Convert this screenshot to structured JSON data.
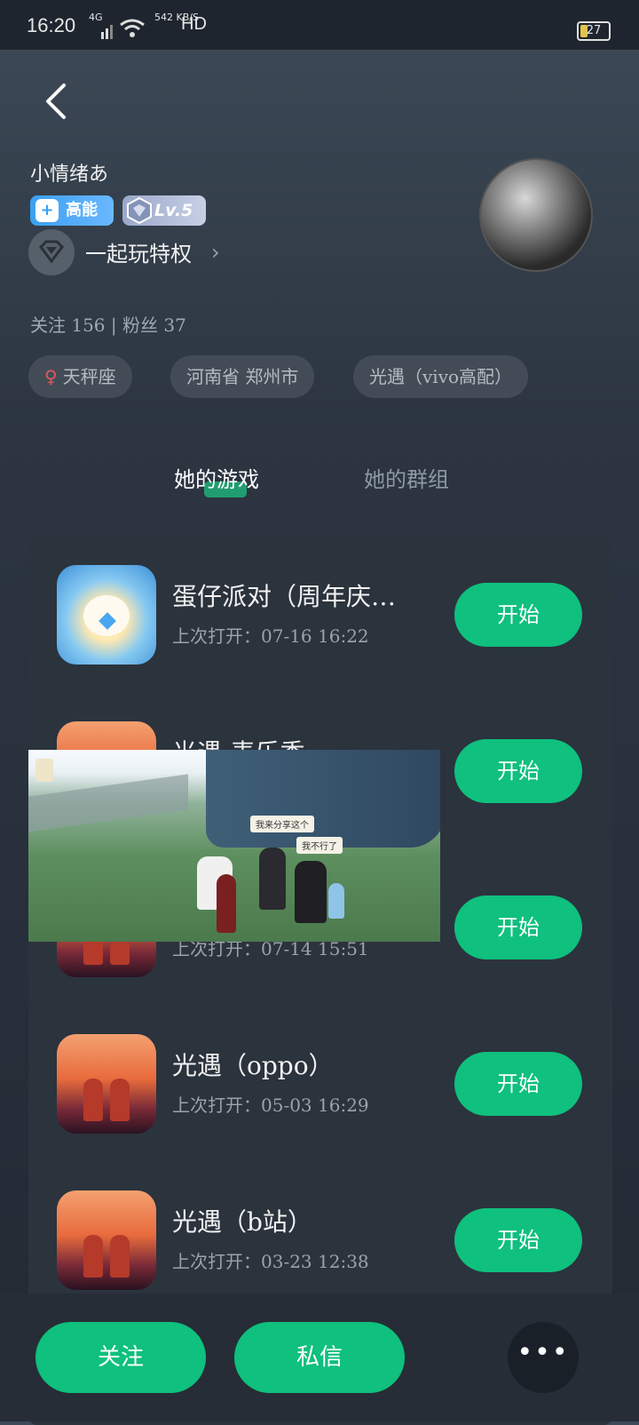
{
  "status_bar": {
    "time": "16:20",
    "network": "4G",
    "speed": "542 KB/S",
    "hd": "HD",
    "battery": "27"
  },
  "profile": {
    "name": "小情绪あ",
    "badge_high": "高能",
    "badge_level": "Lv.5",
    "privilege": "一起玩特权",
    "stats": "关注 156 | 粉丝 37",
    "tags": [
      "天秤座",
      "河南省 郑州市",
      "光遇（vivo高配）"
    ]
  },
  "tabs": {
    "games": "她的游戏",
    "groups": "她的群组"
  },
  "games": [
    {
      "title": "蛋仔派对（周年庆…",
      "last_open": "上次打开：07-16 16:22",
      "button": "开始"
    },
    {
      "title": "光遇-麦乐季",
      "last_open": "",
      "button": "开始"
    },
    {
      "title": "",
      "last_open": "上次打开：07-14 15:51",
      "button": "开始"
    },
    {
      "title": "光遇（oppo）",
      "last_open": "上次打开：05-03 16:29",
      "button": "开始"
    },
    {
      "title": "光遇（b站）",
      "last_open": "上次打开：03-23 12:38",
      "button": "开始"
    }
  ],
  "video_overlay": {
    "caption1": "我来分享这个",
    "caption2": "我不行了"
  },
  "bottom_bar": {
    "follow": "关注",
    "message": "私信",
    "more": "•••"
  },
  "colors": {
    "accent": "#0fc07e",
    "background": "#2c3541",
    "card": "#2b333d"
  }
}
